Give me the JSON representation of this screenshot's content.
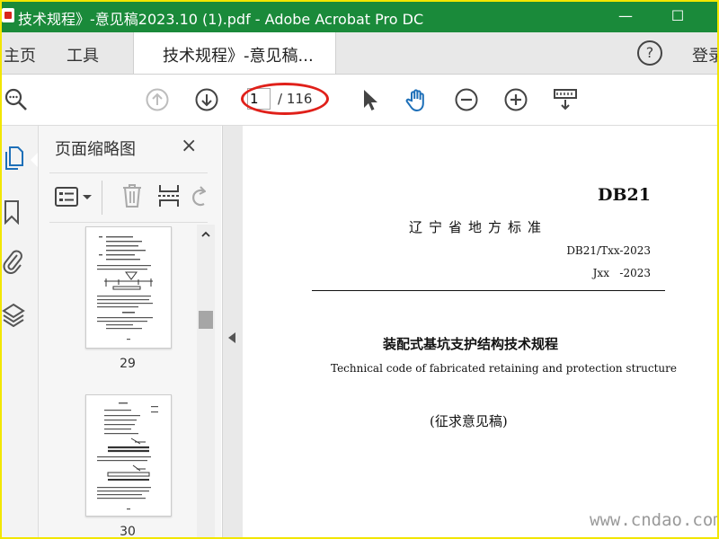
{
  "window": {
    "title": "技术规程》-意见稿2023.10 (1).pdf - Adobe Acrobat Pro DC",
    "minimize": "—",
    "maximize": "☐"
  },
  "tabs": {
    "home": "主页",
    "tools": "工具",
    "document": "技术规程》-意见稿...",
    "close": "×",
    "help": "?",
    "login": "登录"
  },
  "toolbar": {
    "page_current": "1",
    "page_total": "/ 116",
    "accent": "#1d6fb8",
    "highlight": "#e0201a"
  },
  "thumbnail_panel": {
    "title": "页面缩略图",
    "close": "×",
    "pages": [
      {
        "label": "29"
      },
      {
        "label": "30"
      }
    ]
  },
  "document": {
    "std_code": "DB21",
    "std_name": "辽宁省地方标准",
    "number_line1": "DB21/Txx-2023",
    "number_line2": "Jxx   -2023",
    "title_cn": "装配式基坑支护结构技术规程",
    "title_en": "Technical code of fabricated retaining and protection structure",
    "draft_note": "(征求意见稿)"
  },
  "watermark": "www.cndao.com",
  "colors": {
    "titlebar": "#1a8a3a",
    "frame": "#f2e600"
  }
}
